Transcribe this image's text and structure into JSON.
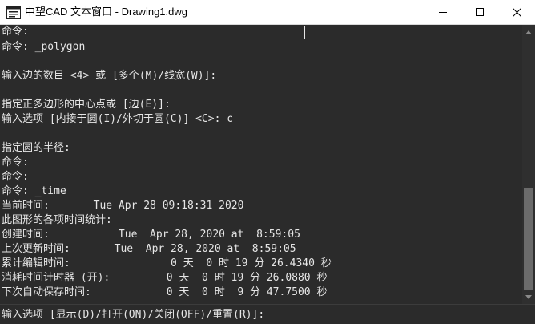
{
  "window": {
    "title": "中望CAD 文本窗口 - Drawing1.dwg",
    "icon": "zwcad-app-icon",
    "controls": {
      "minimize_icon": "minimize-icon",
      "maximize_icon": "maximize-icon",
      "close_icon": "close-icon"
    }
  },
  "console": {
    "lines": [
      "命令:",
      "命令: _polygon",
      "",
      "输入边的数目 <4> 或 [多个(M)/线宽(W)]:",
      "",
      "指定正多边形的中心点或 [边(E)]:",
      "输入选项 [内接于圆(I)/外切于圆(C)] <C>: c",
      "",
      "指定圆的半径:",
      "命令:",
      "命令:",
      "命令: _time",
      "当前时间:       Tue Apr 28 09:18:31 2020",
      "此图形的各项时间统计:",
      "创建时间:           Tue  Apr 28, 2020 at  8:59:05",
      "上次更新时间:       Tue  Apr 28, 2020 at  8:59:05",
      "累计编辑时间:                0 天  0 时 19 分 26.4340 秒",
      "消耗时间计时器 (开):         0 天  0 时 19 分 26.0880 秒",
      "下次自动保存时间:            0 天  0 时  9 分 47.7500 秒"
    ]
  },
  "command_line": {
    "prompt": "输入选项 [显示(D)/打开(ON)/关闭(OFF)/重置(R)]:"
  },
  "colors": {
    "background": "#2b2b2b",
    "text": "#e6e6e6",
    "titlebar": "#ffffff",
    "scroll_thumb": "#6b6b6b"
  }
}
